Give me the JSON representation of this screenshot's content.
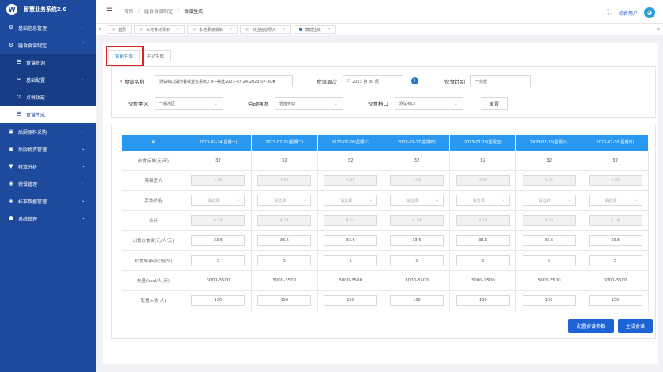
{
  "app": {
    "title": "智慧业务系统2.0",
    "logo_glyph": "W"
  },
  "sidebar": {
    "items": [
      {
        "label": "基础信息管理",
        "icon": "gear-icon",
        "glyph": "⚙",
        "caret": "⌄"
      },
      {
        "label": "膳食食谱制定",
        "icon": "gear-icon",
        "glyph": "⚙",
        "caret": "⌃"
      },
      {
        "label": "食谱查询",
        "icon": "list-icon",
        "glyph": "☰"
      },
      {
        "label": "基础配置",
        "icon": "wrench-icon",
        "glyph": "✂",
        "caret": "⌄"
      },
      {
        "label": "点餐功能",
        "icon": "clock-icon",
        "glyph": "◷"
      },
      {
        "label": "食谱生成",
        "icon": "list-icon",
        "glyph": "☰"
      },
      {
        "label": "后厨原料采购",
        "icon": "box-icon",
        "glyph": "▣",
        "caret": "⌄"
      },
      {
        "label": "后厨物资管理",
        "icon": "box-icon",
        "glyph": "▣",
        "caret": "⌄"
      },
      {
        "label": "核算分析",
        "icon": "filter-icon",
        "glyph": "▼",
        "caret": "⌄"
      },
      {
        "label": "就餐管理",
        "icon": "dining-icon",
        "glyph": "◉",
        "caret": "⌄"
      },
      {
        "label": "标准数据管理",
        "icon": "data-icon",
        "glyph": "◈",
        "caret": "⌄"
      },
      {
        "label": "系统管理",
        "icon": "cart-icon",
        "glyph": "☗",
        "caret": "⌄"
      }
    ]
  },
  "header": {
    "menu_glyph": "☰",
    "breadcrumb": [
      "首页",
      "膳食食谱制定",
      "食谱生成"
    ],
    "breadcrumb_sep": "/",
    "fullscreen_glyph": "⛶",
    "user": "综合用户",
    "avatar_glyph": "◕"
  },
  "page_tabs": {
    "left_arrow": "«",
    "right_arrow": "»",
    "close_glyph": "×",
    "items": [
      "首页",
      "本地食材清单",
      "本地果蔬清单",
      "供应信息导入",
      "食谱生成"
    ]
  },
  "sub_tabs": [
    "智能生成",
    "手动生成"
  ],
  "form": {
    "req_mark": "*",
    "caret": "⌄",
    "recipe_name_label": "食谱名称",
    "recipe_name_value": "测试档口湖湾餐或业务系统2.0—美灶2023-07-24-2023-07-30#",
    "recipe_week_label": "食谱周次",
    "recipe_week_icon": "☐",
    "recipe_week_value": "2023 第 30 周",
    "info_glyph": "i",
    "canteen_label": "伙食灶别",
    "canteen_value": "一类灶",
    "area_label": "伙食类区",
    "area_value": "一般地区",
    "labor_label": "劳动强度",
    "labor_value": "轻度劳动",
    "stall_label": "伙食档口",
    "stall_value": "测试档口",
    "reset_label": "重置"
  },
  "table": {
    "headers": [
      "#",
      "2023-07-24(星期一)",
      "2023-07-25(星期二)",
      "2023-07-26(星期三)",
      "2023-07-27(星期四)",
      "2023-07-28(星期五)",
      "2023-07-29(星期六)",
      "2023-07-30(星期日)"
    ],
    "select_placeholder": "请选择",
    "rows": {
      "standard": {
        "label": "伙食标准(元/天)",
        "value": "32"
      },
      "fee": {
        "label": "菜粮差价",
        "value": "4.05"
      },
      "subsidy": {
        "label": "其他补贴"
      },
      "total": {
        "label": "合计",
        "value": "4.14"
      },
      "plan": {
        "label": "计划伙食费(元/人/天)",
        "value": "33.6"
      },
      "ratio": {
        "label": "伙食费浮动比例(%)",
        "value": "5"
      },
      "calorie": {
        "label": "热量(kcal/人/天)",
        "value": "3000-3500"
      },
      "people": {
        "label": "就餐人数(人)",
        "value": "150"
      }
    }
  },
  "actions": {
    "config_label": "配置食谱参数",
    "generate_label": "生成食谱"
  },
  "colors": {
    "sidebar": "#1d4a9c",
    "primary": "#1d63d6",
    "header_blue": "#2b98f0",
    "highlight": "#e02020"
  }
}
